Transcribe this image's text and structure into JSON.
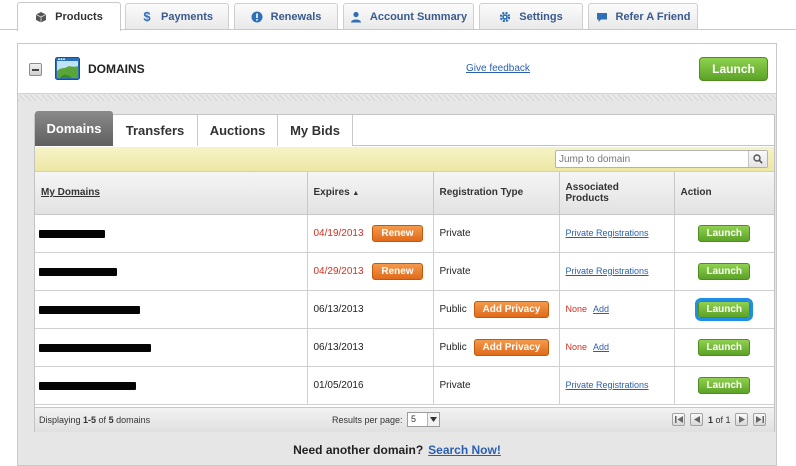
{
  "top_tabs": [
    {
      "label": "Products",
      "icon": "box-icon",
      "active": true
    },
    {
      "label": "Payments",
      "icon": "dollar-icon"
    },
    {
      "label": "Renewals",
      "icon": "alert-icon"
    },
    {
      "label": "Account Summary",
      "icon": "user-icon"
    },
    {
      "label": "Settings",
      "icon": "gear-icon"
    },
    {
      "label": "Refer A Friend",
      "icon": "chat-icon"
    }
  ],
  "panel": {
    "title": "DOMAINS",
    "feedback_link": "Give feedback",
    "launch_label": "Launch"
  },
  "sub_tabs": [
    "Domains",
    "Transfers",
    "Auctions",
    "My Bids"
  ],
  "jump": {
    "placeholder": "Jump to domain"
  },
  "table": {
    "headers": {
      "domain": "My Domains",
      "expires": "Expires",
      "sort_indicator": "▲",
      "reg_type": "Registration Type",
      "associated_1": "Associated",
      "associated_2": "Products",
      "action": "Action"
    },
    "rows": [
      {
        "expires": "04/19/2013",
        "expired_soon": true,
        "renew_label": "Renew",
        "reg_type": "Private",
        "assoc_link": "Private Registrations",
        "action_label": "Launch"
      },
      {
        "expires": "04/29/2013",
        "expired_soon": true,
        "renew_label": "Renew",
        "reg_type": "Private",
        "assoc_link": "Private Registrations",
        "action_label": "Launch"
      },
      {
        "expires": "06/13/2013",
        "reg_type": "Public",
        "privacy_label": "Add Privacy",
        "assoc_none": "None",
        "assoc_add": "Add",
        "action_label": "Launch"
      },
      {
        "expires": "06/13/2013",
        "reg_type": "Public",
        "privacy_label": "Add Privacy",
        "assoc_none": "None",
        "assoc_add": "Add",
        "action_label": "Launch"
      },
      {
        "expires": "01/05/2016",
        "reg_type": "Private",
        "assoc_link": "Private Registrations",
        "action_label": "Launch"
      }
    ]
  },
  "footer": {
    "display_prefix": "Displaying ",
    "display_range": "1-5",
    "display_mid": " of ",
    "display_total": "5",
    "display_suffix": " domains",
    "results_label": "Results per page:",
    "results_value": "5",
    "page_prefix": "",
    "page_current": "1",
    "page_suffix": " of 1"
  },
  "bottom": {
    "text": "Need another domain?",
    "link": "Search Now!"
  },
  "colors": {
    "accent_green": "#5ba227",
    "accent_orange": "#e06a1b",
    "link_blue": "#2a5fb0",
    "highlight": "#1f8fe6",
    "expired_red": "#d22f21"
  }
}
